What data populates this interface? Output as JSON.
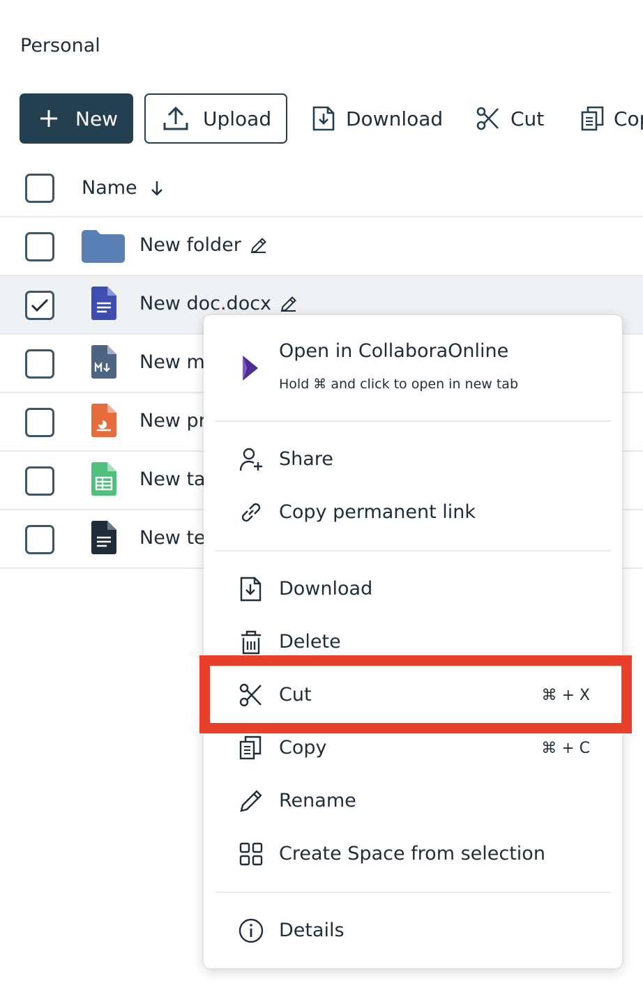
{
  "breadcrumb": "Personal",
  "toolbar": {
    "new_label": "New",
    "upload_label": "Upload",
    "download_label": "Download",
    "cut_label": "Cut",
    "copy_label": "Copy"
  },
  "table": {
    "name_header": "Name",
    "rows": [
      {
        "name": "New folder",
        "type": "folder",
        "selected": false
      },
      {
        "name": "New doc.docx",
        "type": "docx",
        "selected": true
      },
      {
        "name": "New md",
        "type": "markdown",
        "selected": false
      },
      {
        "name": "New pr",
        "type": "presentation",
        "selected": false
      },
      {
        "name": "New ta",
        "type": "spreadsheet",
        "selected": false
      },
      {
        "name": "New te",
        "type": "text",
        "selected": false
      }
    ]
  },
  "context_menu": {
    "open_title": "Open in CollaboraOnline",
    "open_subtitle": "Hold ⌘ and click to open in new tab",
    "share": "Share",
    "copy_link": "Copy permanent link",
    "download": "Download",
    "delete": "Delete",
    "cut": "Cut",
    "cut_shortcut": "⌘ + X",
    "copy": "Copy",
    "copy_shortcut": "⌘ + C",
    "rename": "Rename",
    "create_space": "Create Space from selection",
    "details": "Details"
  },
  "colors": {
    "primary": "#243f50",
    "highlight": "#e8402a",
    "folder": "#5a7fb5",
    "docx": "#3f4db0",
    "presentation": "#e56c3d",
    "spreadsheet": "#4fbf7c"
  }
}
